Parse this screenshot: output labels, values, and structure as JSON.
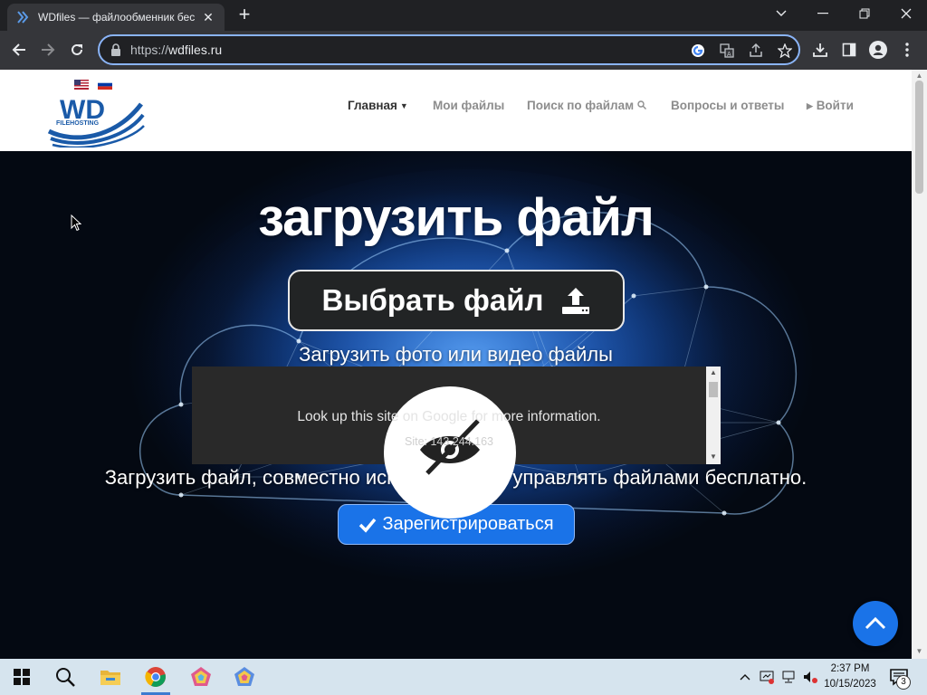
{
  "browser": {
    "tab_title": "WDfiles — файлообменник бес",
    "url_scheme": "https://",
    "url_host": "wdfiles.ru"
  },
  "site": {
    "logo_text": "WD",
    "logo_sub": "FILEHOSTING",
    "nav": [
      {
        "label": "Главная",
        "active": true
      },
      {
        "label": "Мои файлы"
      },
      {
        "label": "Поиск по файлам"
      },
      {
        "label": "Вопросы и ответы"
      },
      {
        "label": "Войти"
      }
    ]
  },
  "hero": {
    "title": "загрузить файл",
    "choose_button": "Выбрать файл",
    "subtitle": "Загрузить фото или видео файлы",
    "description": "Загрузить файл, совместно использовать и управлять файлами бесплатно.",
    "register_button": "Зарегистрироваться"
  },
  "popup": {
    "line1": "Look up this site on Google for more information.",
    "line2": "Site: 143.244.163"
  },
  "taskbar": {
    "time": "2:37 PM",
    "date": "10/15/2023",
    "notifications": "3"
  },
  "colors": {
    "accent": "#1a73e8",
    "chrome_dark": "#202124",
    "chrome_toolbar": "#35363a",
    "hero_bg": "#06122b"
  }
}
